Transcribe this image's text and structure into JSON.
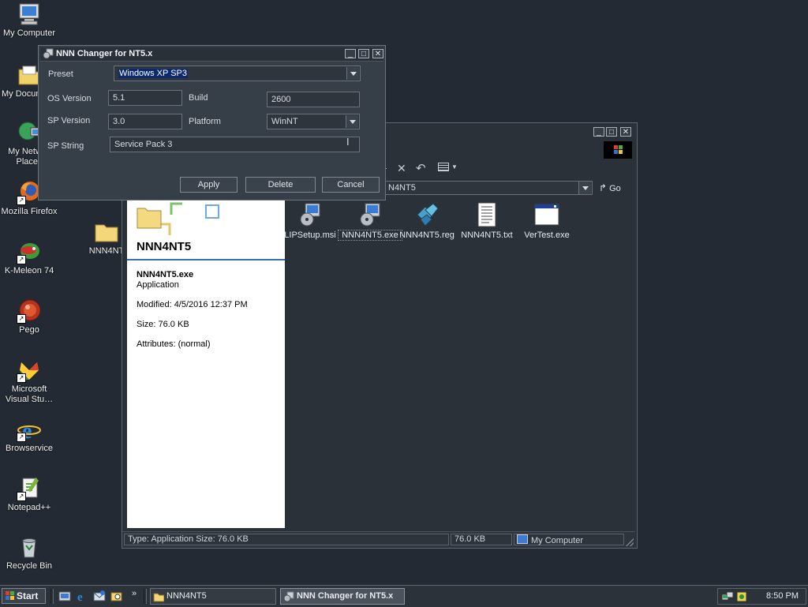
{
  "desktop": {
    "icons": [
      {
        "label": "My Computer"
      },
      {
        "label": "My Docum"
      },
      {
        "label": "My Netw… Places"
      },
      {
        "label": "Mozilla Firefox"
      },
      {
        "label": "NNN4NT"
      },
      {
        "label": "K-Meleon 74"
      },
      {
        "label": "Pego"
      },
      {
        "label": "Microsoft Visual Stu…"
      },
      {
        "label": "Browservice"
      },
      {
        "label": "Notepad++"
      },
      {
        "label": "Recycle Bin"
      }
    ]
  },
  "dialog": {
    "title": "NNN Changer for NT5.x",
    "preset_label": "Preset",
    "preset_value": "Windows XP SP3",
    "os_version_label": "OS Version",
    "os_version_value": "5.1",
    "build_label": "Build",
    "build_value": "2600",
    "sp_version_label": "SP Version",
    "sp_version_value": "3.0",
    "platform_label": "Platform",
    "platform_value": "WinNT",
    "sp_string_label": "SP String",
    "sp_string_value": "Service Pack 3",
    "apply_label": "Apply",
    "delete_label": "Delete",
    "cancel_label": "Cancel"
  },
  "explorer": {
    "address_value": "N4NT5",
    "go_label": "Go",
    "folder_name": "NNN4NT5",
    "details": {
      "file_name": "NNN4NT5.exe",
      "file_type": "Application",
      "modified": "Modified: 4/5/2016 12:37 PM",
      "size": "Size: 76.0 KB",
      "attributes": "Attributes: (normal)"
    },
    "files": [
      {
        "label": "LIPSetup.msi",
        "icon": "msi-installer-icon"
      },
      {
        "label": "NNN4NT5.exe",
        "icon": "exe-setup-icon"
      },
      {
        "label": "NNN4NT5.reg",
        "icon": "registry-file-icon"
      },
      {
        "label": "NNN4NT5.txt",
        "icon": "text-file-icon"
      },
      {
        "label": "VerTest.exe",
        "icon": "window-app-icon"
      }
    ],
    "status": {
      "type_size": "Type: Application Size: 76.0 KB",
      "size": "76.0 KB",
      "zone": "My Computer"
    }
  },
  "taskbar": {
    "start_label": "Start",
    "tasks": [
      {
        "label": "NNN4NT5"
      },
      {
        "label": "NNN Changer for NT5.x"
      }
    ],
    "clock": "8:50 PM"
  },
  "colors": {
    "desktop": "#232a33",
    "selection": "#0b2a6f",
    "panel_white": "#ffffff"
  }
}
